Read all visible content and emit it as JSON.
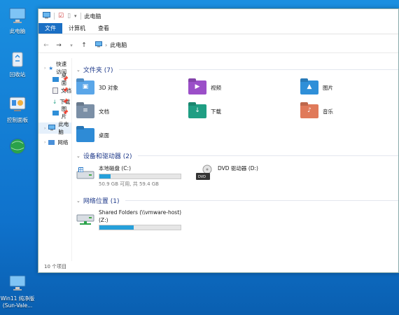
{
  "desktop": {
    "icons": [
      {
        "label": "此电脑",
        "icon": "monitor-icon"
      },
      {
        "label": "回收站",
        "icon": "recycle-bin-icon"
      },
      {
        "label": "控制面板",
        "icon": "control-panel-icon"
      },
      {
        "label": "",
        "icon": "network-globe-icon"
      },
      {
        "label": "Win11 纯净版",
        "label2": "(Sun-Vale...",
        "icon": "monitor-icon"
      }
    ]
  },
  "window": {
    "title": "此电脑",
    "tabs": [
      "文件",
      "计算机",
      "查看"
    ],
    "active_tab": "文件",
    "address": "此电脑",
    "nav": {
      "quick_access": "快速访问",
      "quick_items": [
        "桌面",
        "文档",
        "下载",
        "图片"
      ],
      "this_pc": "此电脑",
      "network": "网络"
    },
    "groups": {
      "folders_header": "文件夹 (7)",
      "devices_header": "设备和驱动器 (2)",
      "network_header": "网络位置 (1)"
    },
    "folders": [
      {
        "name": "3D 对象",
        "color": "#5aa6e8",
        "glyph": "▣"
      },
      {
        "name": "视频",
        "color": "#9b4fc8",
        "glyph": "▶"
      },
      {
        "name": "图片",
        "color": "#2f8fd8",
        "glyph": "▲"
      },
      {
        "name": "文档",
        "color": "#7b8fa6",
        "glyph": "≡"
      },
      {
        "name": "下载",
        "color": "#1f9e83",
        "glyph": "↓"
      },
      {
        "name": "音乐",
        "color": "#e07a5a",
        "glyph": "♪"
      },
      {
        "name": "桌面",
        "color": "#2e8bd6",
        "glyph": ""
      }
    ],
    "drives": [
      {
        "name": "本地磁盘 (C:)",
        "sub": "50.9 GB 可用, 共 59.4 GB",
        "fill_pct": 14
      },
      {
        "name": "DVD 驱动器 (D:)",
        "sub": "",
        "fill_pct": null
      }
    ],
    "network_locations": [
      {
        "name": "Shared Folders (\\\\vmware-host)",
        "name2": "(Z:)",
        "fill_pct": 42
      }
    ],
    "status": "10 个项目"
  }
}
